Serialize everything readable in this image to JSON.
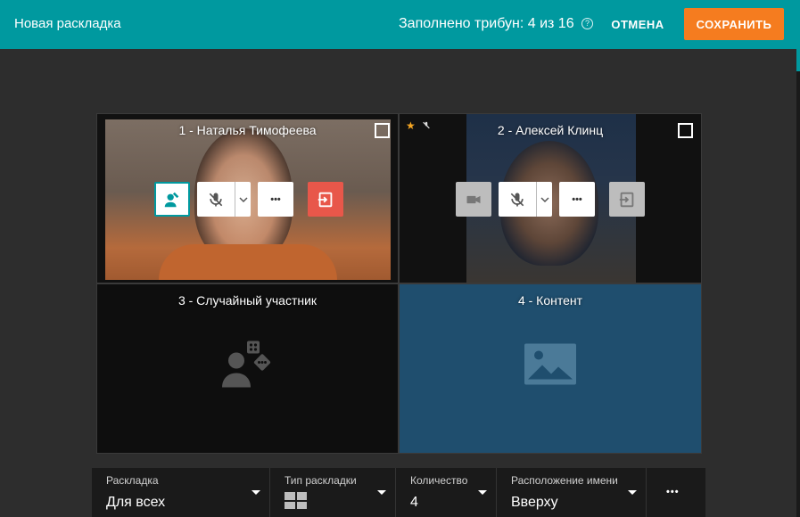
{
  "header": {
    "title": "Новая раскладка",
    "status": "Заполнено трибун: 4 из 16",
    "help_glyph": "?",
    "cancel_label": "ОТМЕНА",
    "save_label": "СОХРАНИТЬ"
  },
  "tiles": [
    {
      "label": "1 - Наталья Тимофеева"
    },
    {
      "label": "2 - Алексей Клинц"
    },
    {
      "label": "3 - Случайный участник"
    },
    {
      "label": "4 - Контент"
    }
  ],
  "controls": {
    "more_glyph": "•••"
  },
  "bottom": {
    "layout_label": "Раскладка",
    "layout_value": "Для всех",
    "type_label": "Тип раскладки",
    "count_label": "Количество",
    "count_value": "4",
    "name_pos_label": "Расположение имени",
    "name_pos_value": "Вверху",
    "more_glyph": "•••"
  },
  "colors": {
    "accent": "#00999f",
    "save": "#f57c1f",
    "kick": "#e8574a",
    "content_tile": "#1f4e6e"
  }
}
